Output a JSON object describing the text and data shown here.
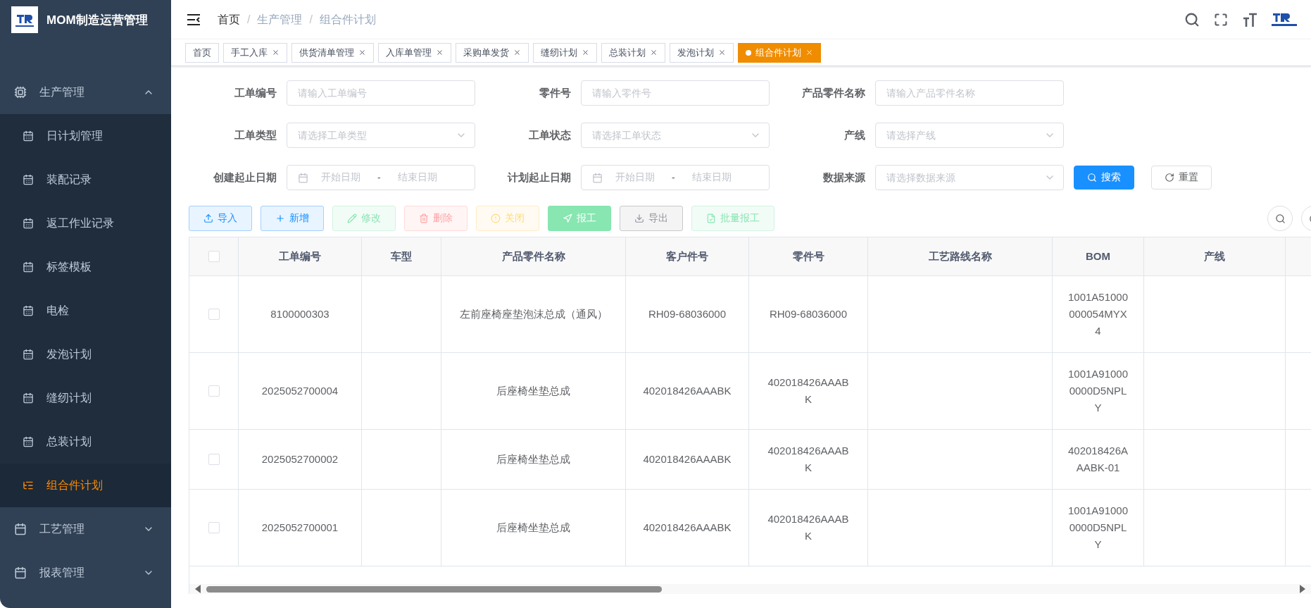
{
  "sidebar": {
    "logo_text": "MOM制造运营管理",
    "menu": [
      {
        "label": "生产管理",
        "expanded": true,
        "children": [
          {
            "label": "日计划管理",
            "kind": "page",
            "selected": false
          },
          {
            "label": "装配记录",
            "kind": "page",
            "selected": false
          },
          {
            "label": "返工作业记录",
            "kind": "page",
            "selected": false
          },
          {
            "label": "标签模板",
            "kind": "page",
            "selected": false
          },
          {
            "label": "电检",
            "kind": "page",
            "selected": false
          },
          {
            "label": "发泡计划",
            "kind": "page",
            "selected": false
          },
          {
            "label": "缝纫计划",
            "kind": "page",
            "selected": false
          },
          {
            "label": "总装计划",
            "kind": "page",
            "selected": false
          },
          {
            "label": "组合件计划",
            "kind": "tree",
            "selected": true
          }
        ]
      },
      {
        "label": "工艺管理",
        "expanded": false
      },
      {
        "label": "报表管理",
        "expanded": false
      }
    ]
  },
  "breadcrumb": [
    "首页",
    "生产管理",
    "组合件计划"
  ],
  "breadcrumb_separator": "/",
  "tabs": [
    {
      "label": "首页",
      "closable": false,
      "selected": false
    },
    {
      "label": "手工入库",
      "closable": true,
      "selected": false
    },
    {
      "label": "供货清单管理",
      "closable": true,
      "selected": false
    },
    {
      "label": "入库单管理",
      "closable": true,
      "selected": false
    },
    {
      "label": "采购单发货",
      "closable": true,
      "selected": false
    },
    {
      "label": "缝纫计划",
      "closable": true,
      "selected": false
    },
    {
      "label": "总装计划",
      "closable": true,
      "selected": false
    },
    {
      "label": "发泡计划",
      "closable": true,
      "selected": false
    },
    {
      "label": "组合件计划",
      "closable": true,
      "selected": true
    }
  ],
  "filters": [
    {
      "label": "工单编号",
      "kind": "input",
      "placeholder": "请输入工单编号"
    },
    {
      "label": "零件号",
      "kind": "input",
      "placeholder": "请输入零件号"
    },
    {
      "label": "产品零件名称",
      "kind": "input",
      "placeholder": "请输入产品零件名称"
    },
    {
      "label": "工单类型",
      "kind": "select",
      "placeholder": "请选择工单类型"
    },
    {
      "label": "工单状态",
      "kind": "select",
      "placeholder": "请选择工单状态"
    },
    {
      "label": "产线",
      "kind": "select",
      "placeholder": "请选择产线"
    },
    {
      "label": "创建起止日期",
      "kind": "daterange",
      "start_placeholder": "开始日期",
      "separator": "-",
      "end_placeholder": "结束日期"
    },
    {
      "label": "计划起止日期",
      "kind": "daterange",
      "start_placeholder": "开始日期",
      "separator": "-",
      "end_placeholder": "结束日期"
    },
    {
      "label": "数据来源",
      "kind": "select",
      "placeholder": "请选择数据来源"
    }
  ],
  "filter_buttons": [
    {
      "label": "搜索",
      "kind": "search"
    },
    {
      "label": "重置",
      "kind": "reset"
    }
  ],
  "toolbar": [
    {
      "label": "导入",
      "kind": "import",
      "disabled": false
    },
    {
      "label": "新增",
      "kind": "add",
      "disabled": false
    },
    {
      "label": "修改",
      "kind": "edit",
      "disabled": true
    },
    {
      "label": "删除",
      "kind": "delete",
      "disabled": true
    },
    {
      "label": "关闭",
      "kind": "close",
      "disabled": true
    },
    {
      "label": "报工",
      "kind": "report",
      "disabled": true
    },
    {
      "label": "导出",
      "kind": "export",
      "disabled": false
    },
    {
      "label": "批量报工",
      "kind": "batch",
      "disabled": true
    }
  ],
  "table": {
    "select_all": {
      "checked": false
    },
    "columns": [
      "工单编号",
      "车型",
      "产品零件名称",
      "客户件号",
      "零件号",
      "工艺路线名称",
      "BOM",
      "产线"
    ],
    "rows": [
      {
        "checked": false,
        "cells": [
          "8100000303",
          "",
          "左前座椅座垫泡沫总成（通风）",
          "RH09-68036000",
          "RH09-68036000",
          "",
          "1001A51000000054MYX4",
          ""
        ]
      },
      {
        "checked": false,
        "cells": [
          "2025052700004",
          "",
          "后座椅坐垫总成",
          "402018426AAABK",
          "402018426AAABK",
          "",
          "1001A910000000D5NPLY",
          ""
        ]
      },
      {
        "checked": false,
        "cells": [
          "2025052700002",
          "",
          "后座椅坐垫总成",
          "402018426AAABK",
          "402018426AAABK",
          "",
          "402018426AAABK-01",
          ""
        ]
      },
      {
        "checked": false,
        "cells": [
          "2025052700001",
          "",
          "后座椅坐垫总成",
          "402018426AAABK",
          "402018426AAABK",
          "",
          "1001A910000000D5NPLY",
          ""
        ]
      }
    ]
  }
}
